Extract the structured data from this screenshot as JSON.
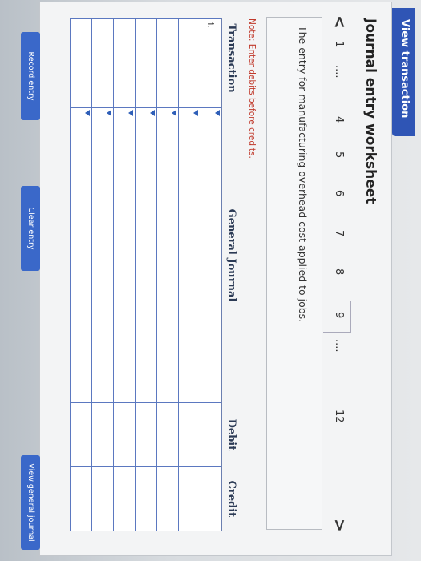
{
  "header": {
    "tab_label": "View transaction list"
  },
  "worksheet": {
    "title": "Journal entry worksheet",
    "pager": {
      "prev": "<",
      "next": ">",
      "pages": [
        "1",
        "....",
        "4",
        "5",
        "6",
        "7",
        "8",
        "9",
        "....",
        "12"
      ],
      "active": "9"
    },
    "description": "The entry for manufacturing overhead cost applied to jobs.",
    "note": "Note: Enter debits before credits."
  },
  "table": {
    "headers": [
      "Transaction",
      "General Journal",
      "Debit",
      "Credit"
    ],
    "rows": [
      [
        "i.",
        "",
        "",
        ""
      ],
      [
        "",
        "",
        "",
        ""
      ],
      [
        "",
        "",
        "",
        ""
      ],
      [
        "",
        "",
        "",
        ""
      ],
      [
        "",
        "",
        "",
        ""
      ],
      [
        "",
        "",
        "",
        ""
      ],
      [
        "",
        "",
        "",
        ""
      ]
    ]
  },
  "buttons": {
    "record": "Record entry",
    "clear": "Clear entry",
    "view_journal": "View general journal"
  },
  "colors": {
    "accent": "#2f55b5",
    "note": "#c0392b",
    "grid": "#5b78c0"
  }
}
